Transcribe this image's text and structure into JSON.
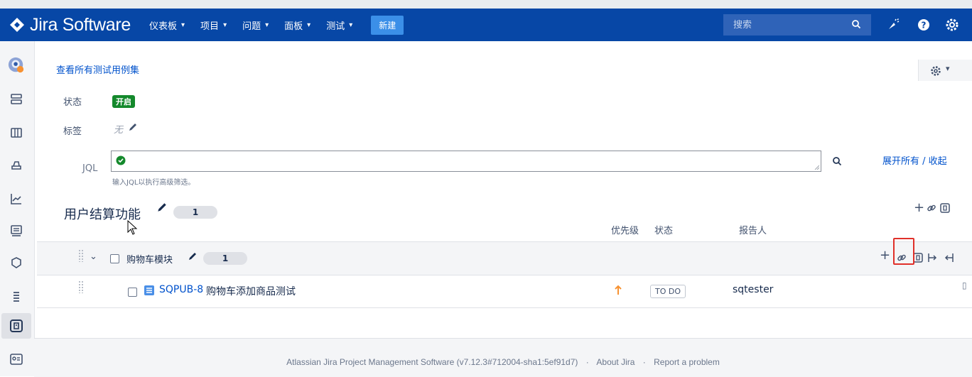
{
  "nav": {
    "brand": "Jira Software",
    "menu": [
      {
        "label": "仪表板"
      },
      {
        "label": "项目"
      },
      {
        "label": "问题"
      },
      {
        "label": "面板"
      },
      {
        "label": "测试"
      }
    ],
    "create_label": "新建",
    "search_placeholder": "搜索"
  },
  "page": {
    "view_all_link": "查看所有测试用例集",
    "status_label": "状态",
    "status_value": "开启",
    "tags_label": "标签",
    "tags_value": "无",
    "jql_label": "JQL",
    "jql_hint": "输入JQL以执行高级筛选。",
    "expand_collapse": "展开所有 / 收起"
  },
  "suite": {
    "name": "用户结算功能",
    "count": "1",
    "columns": {
      "priority": "优先级",
      "status": "状态",
      "reporter": "报告人"
    }
  },
  "module": {
    "name": "购物车模块",
    "count": "1"
  },
  "issues": [
    {
      "key": "SQPUB-8",
      "title": "购物车添加商品测试",
      "status": "TO DO",
      "reporter": "sqtester"
    }
  ],
  "footer": {
    "text": "Atlassian Jira Project Management Software (v7.12.3#712004-sha1:5ef91d7)",
    "sep": "·",
    "about": "About Jira",
    "report": "Report a problem"
  },
  "colors": {
    "nav_bg": "#0747a6",
    "link": "#0052cc",
    "status_green": "#14892c",
    "highlight_red": "#e0302a",
    "priority_orange": "#f79232"
  }
}
